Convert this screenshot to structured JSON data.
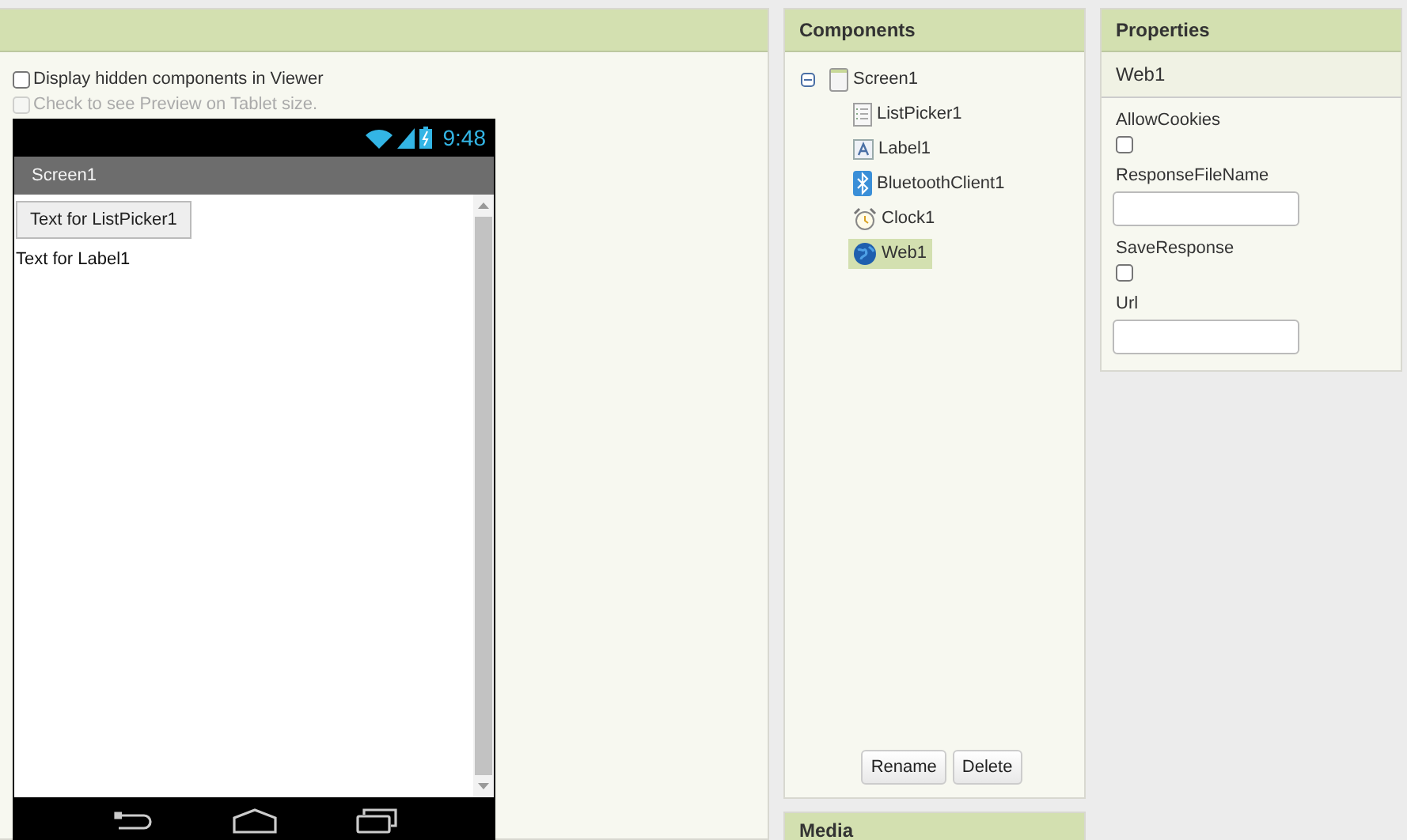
{
  "viewer": {
    "options": [
      {
        "label": "Display hidden components in Viewer",
        "checked": false,
        "disabled": false
      },
      {
        "label": "Check to see Preview on Tablet size.",
        "checked": false,
        "disabled": true
      }
    ],
    "phone": {
      "time": "9:48",
      "title": "Screen1",
      "list_picker": "Text for ListPicker1",
      "label": "Text for Label1"
    }
  },
  "components": {
    "title": "Components",
    "tree": [
      {
        "name": "Screen1",
        "kind": "screen",
        "expanded": true,
        "selected": false,
        "children": [
          {
            "name": "ListPicker1",
            "kind": "listpicker",
            "selected": false
          },
          {
            "name": "Label1",
            "kind": "label",
            "selected": false
          },
          {
            "name": "BluetoothClient1",
            "kind": "bluetooth",
            "selected": false
          },
          {
            "name": "Clock1",
            "kind": "clock",
            "selected": false
          },
          {
            "name": "Web1",
            "kind": "web",
            "selected": true
          }
        ]
      }
    ],
    "buttons": [
      "Rename",
      "Delete"
    ]
  },
  "properties": {
    "title": "Properties",
    "component": "Web1",
    "items": [
      {
        "kind": "checkbox",
        "label": "AllowCookies",
        "checked": false
      },
      {
        "kind": "text",
        "label": "ResponseFileName"
      },
      {
        "kind": "checkbox",
        "label": "SaveResponse",
        "checked": false
      },
      {
        "kind": "text",
        "label": "Url"
      }
    ]
  },
  "media": {
    "title": "Media"
  }
}
